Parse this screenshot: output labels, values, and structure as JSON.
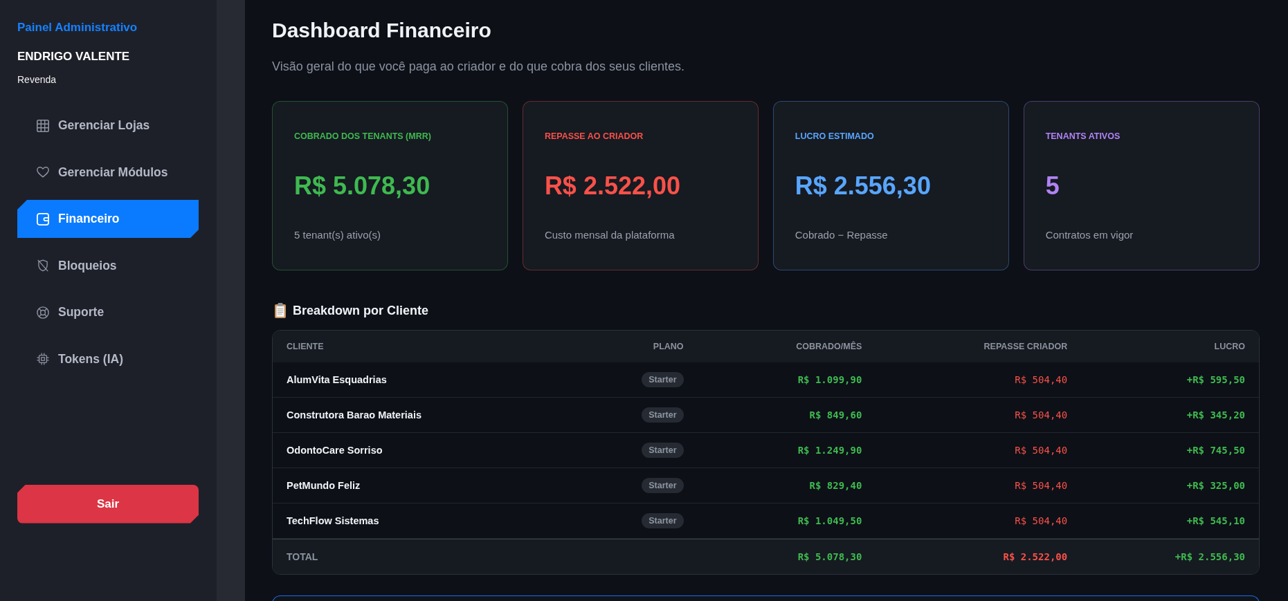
{
  "sidebar": {
    "title": "Painel Administrativo",
    "user_name": "ENDRIGO VALENTE",
    "user_role": "Revenda",
    "items": [
      {
        "label": "Gerenciar Lojas",
        "selected": false
      },
      {
        "label": "Gerenciar Módulos",
        "selected": false
      },
      {
        "label": "Financeiro",
        "selected": true
      },
      {
        "label": "Bloqueios",
        "selected": false
      },
      {
        "label": "Suporte",
        "selected": false
      },
      {
        "label": "Tokens (IA)",
        "selected": false
      }
    ],
    "logout_button": "Sair"
  },
  "header": {
    "title": "Dashboard Financeiro",
    "subtitle": "Visão geral do que você paga ao criador e do que cobra dos seus clientes."
  },
  "cards": [
    {
      "label": "COBRADO DOS TENANTS (MRR)",
      "value": "R$ 5.078,30",
      "caption": "5 tenant(s) ativo(s)",
      "color": "#3fb950"
    },
    {
      "label": "REPASSE AO CRIADOR",
      "value": "R$ 2.522,00",
      "caption": "Custo mensal da plataforma",
      "color": "#f85149"
    },
    {
      "label": "LUCRO ESTIMADO",
      "value": "R$ 2.556,30",
      "caption": "Cobrado − Repasse",
      "color": "#58a6ff"
    },
    {
      "label": "TENANTS ATIVOS",
      "value": "5",
      "caption": "Contratos em vigor",
      "color": "#b083f5"
    }
  ],
  "breakdown": {
    "title": "Breakdown por Cliente",
    "columns": [
      "CLIENTE",
      "PLANO",
      "COBRADO/MÊS",
      "REPASSE CRIADOR",
      "LUCRO"
    ],
    "rows": [
      {
        "client": "AlumVita Esquadrias",
        "plan": "Starter",
        "charged": "R$ 1.099,90",
        "creator_share": "R$ 504,40",
        "profit": "+R$ 595,50"
      },
      {
        "client": "Construtora Barao Materiais",
        "plan": "Starter",
        "charged": "R$ 849,60",
        "creator_share": "R$ 504,40",
        "profit": "+R$ 345,20"
      },
      {
        "client": "OdontoCare Sorriso",
        "plan": "Starter",
        "charged": "R$ 1.249,90",
        "creator_share": "R$ 504,40",
        "profit": "+R$ 745,50"
      },
      {
        "client": "PetMundo Feliz",
        "plan": "Starter",
        "charged": "R$ 829,40",
        "creator_share": "R$ 504,40",
        "profit": "+R$ 325,00"
      },
      {
        "client": "TechFlow Sistemas",
        "plan": "Starter",
        "charged": "R$ 1.049,50",
        "creator_share": "R$ 504,40",
        "profit": "+R$ 545,10"
      }
    ],
    "total": {
      "label": "TOTAL",
      "charged": "R$ 5.078,30",
      "creator_share": "R$ 2.522,00",
      "profit": "+R$ 2.556,30"
    }
  }
}
